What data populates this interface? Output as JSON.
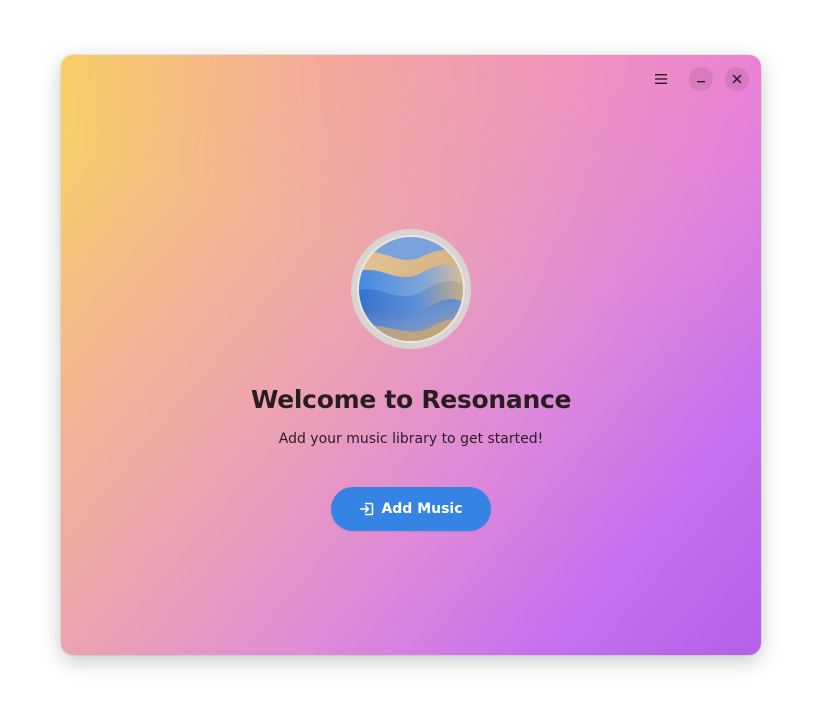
{
  "window": {
    "icons": {
      "menu": "hamburger-menu-icon",
      "minimize": "minimize-icon",
      "close": "close-icon"
    }
  },
  "welcome": {
    "title": "Welcome to Resonance",
    "subtitle": "Add your music library to get started!",
    "logo": "resonance-app-logo"
  },
  "actions": {
    "add_music_label": "Add Music",
    "add_music_icon": "import-icon"
  },
  "colors": {
    "accent": "#3584e4",
    "gradient_start": "#f7d85a",
    "gradient_mid": "#eda3b0",
    "gradient_end": "#b45fe9",
    "text": "#2a1d22"
  }
}
